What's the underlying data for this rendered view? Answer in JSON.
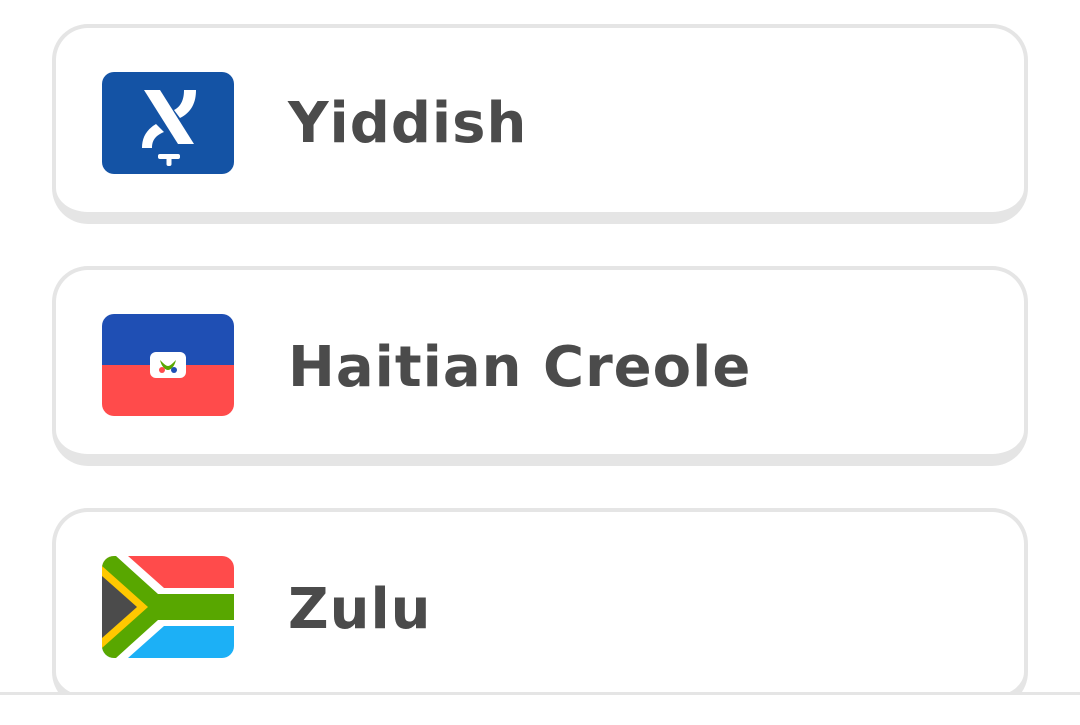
{
  "languages": [
    {
      "name": "Yiddish",
      "flag_icon": "yiddish-flag-icon",
      "colors": {
        "background": "#1453a5",
        "symbol": "#ffffff"
      }
    },
    {
      "name": "Haitian Creole",
      "flag_icon": "haiti-flag-icon",
      "colors": {
        "top": "#1f4fb4",
        "bottom": "#ff4b4b",
        "emblem": "#ffffff"
      }
    },
    {
      "name": "Zulu",
      "flag_icon": "south-africa-flag-icon",
      "colors": {
        "red": "#ff4b4b",
        "blue": "#1cb0f6",
        "green": "#58a700",
        "yellow": "#ffc800",
        "black": "#4b4b4b",
        "white": "#ffffff"
      }
    }
  ],
  "theme": {
    "text_color": "#4b4b4b",
    "card_border": "#e5e5e5",
    "background": "#ffffff"
  }
}
